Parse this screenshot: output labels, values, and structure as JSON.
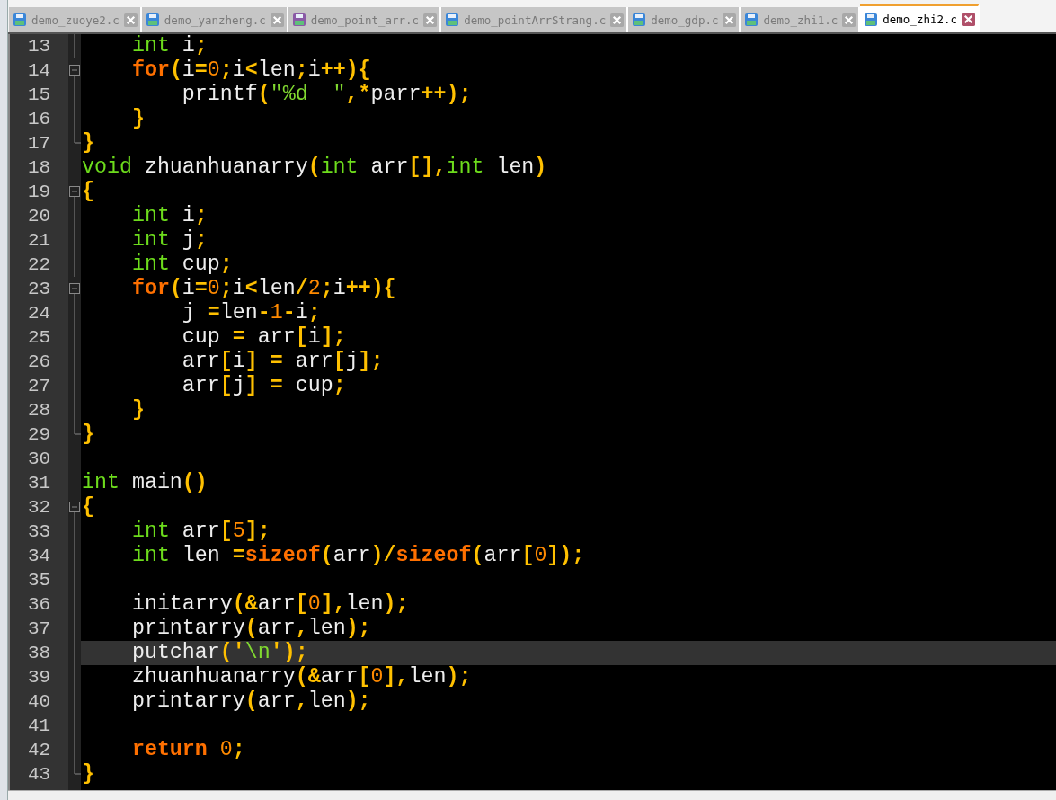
{
  "tabs": [
    {
      "label": "demo_zuoye2.c",
      "selected": false,
      "color": "#3a86d8"
    },
    {
      "label": "demo_yanzheng.c",
      "selected": false,
      "color": "#3a86d8"
    },
    {
      "label": "demo_point_arr.c",
      "selected": false,
      "color": "#8a5aa6"
    },
    {
      "label": "demo_pointArrStrang.c",
      "selected": false,
      "color": "#3a86d8"
    },
    {
      "label": "demo_gdp.c",
      "selected": false,
      "color": "#3a86d8"
    },
    {
      "label": "demo_zhi1.c",
      "selected": false,
      "color": "#3a86d8"
    },
    {
      "label": "demo_zhi2.c",
      "selected": true,
      "color": "#3a86d8"
    }
  ],
  "lines": [
    {
      "number": "13",
      "fold": {
        "kind": "line"
      },
      "current": false,
      "tokens": [
        {
          "text": "    int",
          "kind": "type"
        },
        {
          "text": " i",
          "kind": "id"
        },
        {
          "text": ";",
          "kind": "op"
        }
      ]
    },
    {
      "number": "14",
      "fold": {
        "kind": "open"
      },
      "current": false,
      "tokens": [
        {
          "text": "    for",
          "kind": "kw"
        },
        {
          "text": "(",
          "kind": "op"
        },
        {
          "text": "i",
          "kind": "id"
        },
        {
          "text": "=",
          "kind": "op"
        },
        {
          "text": "0",
          "kind": "num"
        },
        {
          "text": ";",
          "kind": "op"
        },
        {
          "text": "i",
          "kind": "id"
        },
        {
          "text": "<",
          "kind": "op"
        },
        {
          "text": "len",
          "kind": "id"
        },
        {
          "text": ";",
          "kind": "op"
        },
        {
          "text": "i",
          "kind": "id"
        },
        {
          "text": "++",
          "kind": "op"
        },
        {
          "text": ")",
          "kind": "op"
        },
        {
          "text": "{",
          "kind": "op"
        }
      ]
    },
    {
      "number": "15",
      "fold": {
        "kind": "line"
      },
      "current": false,
      "tokens": [
        {
          "text": "        printf",
          "kind": "id"
        },
        {
          "text": "(",
          "kind": "op"
        },
        {
          "text": "\"%d  \"",
          "kind": "str"
        },
        {
          "text": ",",
          "kind": "op"
        },
        {
          "text": "*",
          "kind": "op"
        },
        {
          "text": "parr",
          "kind": "id"
        },
        {
          "text": "++",
          "kind": "op"
        },
        {
          "text": ")",
          "kind": "op"
        },
        {
          "text": ";",
          "kind": "op"
        }
      ]
    },
    {
      "number": "16",
      "fold": {
        "kind": "line"
      },
      "current": false,
      "tokens": [
        {
          "text": "    }",
          "kind": "op"
        }
      ]
    },
    {
      "number": "17",
      "fold": {
        "kind": "end"
      },
      "current": false,
      "tokens": [
        {
          "text": "}",
          "kind": "op"
        }
      ]
    },
    {
      "number": "18",
      "current": false,
      "tokens": [
        {
          "text": "void",
          "kind": "type"
        },
        {
          "text": " zhuanhuanarry",
          "kind": "id"
        },
        {
          "text": "(",
          "kind": "op"
        },
        {
          "text": "int",
          "kind": "type"
        },
        {
          "text": " arr",
          "kind": "id"
        },
        {
          "text": "[]",
          "kind": "op"
        },
        {
          "text": ",",
          "kind": "op"
        },
        {
          "text": "int",
          "kind": "type"
        },
        {
          "text": " len",
          "kind": "id"
        },
        {
          "text": ")",
          "kind": "op"
        }
      ]
    },
    {
      "number": "19",
      "fold": {
        "kind": "open"
      },
      "current": false,
      "tokens": [
        {
          "text": "{",
          "kind": "op"
        }
      ]
    },
    {
      "number": "20",
      "fold": {
        "kind": "line"
      },
      "current": false,
      "tokens": [
        {
          "text": "    int",
          "kind": "type"
        },
        {
          "text": " i",
          "kind": "id"
        },
        {
          "text": ";",
          "kind": "op"
        }
      ]
    },
    {
      "number": "21",
      "fold": {
        "kind": "line"
      },
      "current": false,
      "tokens": [
        {
          "text": "    int",
          "kind": "type"
        },
        {
          "text": " j",
          "kind": "id"
        },
        {
          "text": ";",
          "kind": "op"
        }
      ]
    },
    {
      "number": "22",
      "fold": {
        "kind": "line"
      },
      "current": false,
      "tokens": [
        {
          "text": "    int",
          "kind": "type"
        },
        {
          "text": " cup",
          "kind": "id"
        },
        {
          "text": ";",
          "kind": "op"
        }
      ]
    },
    {
      "number": "23",
      "fold": {
        "kind": "open"
      },
      "current": false,
      "tokens": [
        {
          "text": "    for",
          "kind": "kw"
        },
        {
          "text": "(",
          "kind": "op"
        },
        {
          "text": "i",
          "kind": "id"
        },
        {
          "text": "=",
          "kind": "op"
        },
        {
          "text": "0",
          "kind": "num"
        },
        {
          "text": ";",
          "kind": "op"
        },
        {
          "text": "i",
          "kind": "id"
        },
        {
          "text": "<",
          "kind": "op"
        },
        {
          "text": "len",
          "kind": "id"
        },
        {
          "text": "/",
          "kind": "op"
        },
        {
          "text": "2",
          "kind": "num"
        },
        {
          "text": ";",
          "kind": "op"
        },
        {
          "text": "i",
          "kind": "id"
        },
        {
          "text": "++",
          "kind": "op"
        },
        {
          "text": ")",
          "kind": "op"
        },
        {
          "text": "{",
          "kind": "op"
        }
      ]
    },
    {
      "number": "24",
      "fold": {
        "kind": "line"
      },
      "current": false,
      "tokens": [
        {
          "text": "        j ",
          "kind": "id"
        },
        {
          "text": "=",
          "kind": "op"
        },
        {
          "text": "len",
          "kind": "id"
        },
        {
          "text": "-",
          "kind": "op"
        },
        {
          "text": "1",
          "kind": "num"
        },
        {
          "text": "-",
          "kind": "op"
        },
        {
          "text": "i",
          "kind": "id"
        },
        {
          "text": ";",
          "kind": "op"
        }
      ]
    },
    {
      "number": "25",
      "fold": {
        "kind": "line"
      },
      "current": false,
      "tokens": [
        {
          "text": "        cup ",
          "kind": "id"
        },
        {
          "text": "=",
          "kind": "op"
        },
        {
          "text": " arr",
          "kind": "id"
        },
        {
          "text": "[",
          "kind": "op"
        },
        {
          "text": "i",
          "kind": "id"
        },
        {
          "text": "]",
          "kind": "op"
        },
        {
          "text": ";",
          "kind": "op"
        }
      ]
    },
    {
      "number": "26",
      "fold": {
        "kind": "line"
      },
      "current": false,
      "tokens": [
        {
          "text": "        arr",
          "kind": "id"
        },
        {
          "text": "[",
          "kind": "op"
        },
        {
          "text": "i",
          "kind": "id"
        },
        {
          "text": "]",
          "kind": "op"
        },
        {
          "text": " =",
          "kind": "op"
        },
        {
          "text": " arr",
          "kind": "id"
        },
        {
          "text": "[",
          "kind": "op"
        },
        {
          "text": "j",
          "kind": "id"
        },
        {
          "text": "]",
          "kind": "op"
        },
        {
          "text": ";",
          "kind": "op"
        }
      ]
    },
    {
      "number": "27",
      "fold": {
        "kind": "line"
      },
      "current": false,
      "tokens": [
        {
          "text": "        arr",
          "kind": "id"
        },
        {
          "text": "[",
          "kind": "op"
        },
        {
          "text": "j",
          "kind": "id"
        },
        {
          "text": "]",
          "kind": "op"
        },
        {
          "text": " =",
          "kind": "op"
        },
        {
          "text": " cup",
          "kind": "id"
        },
        {
          "text": ";",
          "kind": "op"
        }
      ]
    },
    {
      "number": "28",
      "fold": {
        "kind": "line"
      },
      "current": false,
      "tokens": [
        {
          "text": "    }",
          "kind": "op"
        }
      ]
    },
    {
      "number": "29",
      "fold": {
        "kind": "end"
      },
      "current": false,
      "tokens": [
        {
          "text": "}",
          "kind": "op"
        }
      ]
    },
    {
      "number": "30",
      "current": false
    },
    {
      "number": "31",
      "current": false,
      "tokens": [
        {
          "text": "int",
          "kind": "type"
        },
        {
          "text": " main",
          "kind": "id"
        },
        {
          "text": "()",
          "kind": "op"
        }
      ]
    },
    {
      "number": "32",
      "fold": {
        "kind": "open"
      },
      "current": false,
      "tokens": [
        {
          "text": "{",
          "kind": "op"
        }
      ]
    },
    {
      "number": "33",
      "fold": {
        "kind": "line"
      },
      "current": false,
      "tokens": [
        {
          "text": "    int",
          "kind": "type"
        },
        {
          "text": " arr",
          "kind": "id"
        },
        {
          "text": "[",
          "kind": "op"
        },
        {
          "text": "5",
          "kind": "num"
        },
        {
          "text": "]",
          "kind": "op"
        },
        {
          "text": ";",
          "kind": "op"
        }
      ]
    },
    {
      "number": "34",
      "fold": {
        "kind": "line"
      },
      "current": false,
      "tokens": [
        {
          "text": "    int",
          "kind": "type"
        },
        {
          "text": " len ",
          "kind": "id"
        },
        {
          "text": "=",
          "kind": "op"
        },
        {
          "text": "sizeof",
          "kind": "kw"
        },
        {
          "text": "(",
          "kind": "op"
        },
        {
          "text": "arr",
          "kind": "id"
        },
        {
          "text": ")",
          "kind": "op"
        },
        {
          "text": "/",
          "kind": "op"
        },
        {
          "text": "sizeof",
          "kind": "kw"
        },
        {
          "text": "(",
          "kind": "op"
        },
        {
          "text": "arr",
          "kind": "id"
        },
        {
          "text": "[",
          "kind": "op"
        },
        {
          "text": "0",
          "kind": "num"
        },
        {
          "text": "]",
          "kind": "op"
        },
        {
          "text": ")",
          "kind": "op"
        },
        {
          "text": ";",
          "kind": "op"
        }
      ]
    },
    {
      "number": "35",
      "fold": {
        "kind": "line"
      },
      "current": false
    },
    {
      "number": "36",
      "fold": {
        "kind": "line"
      },
      "current": false,
      "tokens": [
        {
          "text": "    initarry",
          "kind": "id"
        },
        {
          "text": "(",
          "kind": "op"
        },
        {
          "text": "&",
          "kind": "op"
        },
        {
          "text": "arr",
          "kind": "id"
        },
        {
          "text": "[",
          "kind": "op"
        },
        {
          "text": "0",
          "kind": "num"
        },
        {
          "text": "]",
          "kind": "op"
        },
        {
          "text": ",",
          "kind": "op"
        },
        {
          "text": "len",
          "kind": "id"
        },
        {
          "text": ")",
          "kind": "op"
        },
        {
          "text": ";",
          "kind": "op"
        }
      ]
    },
    {
      "number": "37",
      "fold": {
        "kind": "line"
      },
      "current": false,
      "tokens": [
        {
          "text": "    printarry",
          "kind": "id"
        },
        {
          "text": "(",
          "kind": "op"
        },
        {
          "text": "arr",
          "kind": "id"
        },
        {
          "text": ",",
          "kind": "op"
        },
        {
          "text": "len",
          "kind": "id"
        },
        {
          "text": ")",
          "kind": "op"
        },
        {
          "text": ";",
          "kind": "op"
        }
      ]
    },
    {
      "number": "38",
      "fold": {
        "kind": "line"
      },
      "current": true,
      "tokens": [
        {
          "text": "    putchar",
          "kind": "id"
        },
        {
          "text": "(",
          "kind": "op"
        },
        {
          "text": "'",
          "kind": "op"
        },
        {
          "text": "\\n",
          "kind": "str"
        },
        {
          "text": "'",
          "kind": "op"
        },
        {
          "text": ")",
          "kind": "op"
        },
        {
          "text": ";",
          "kind": "op"
        }
      ]
    },
    {
      "number": "39",
      "fold": {
        "kind": "line"
      },
      "current": false,
      "tokens": [
        {
          "text": "    zhuanhuanarry",
          "kind": "id"
        },
        {
          "text": "(",
          "kind": "op"
        },
        {
          "text": "&",
          "kind": "op"
        },
        {
          "text": "arr",
          "kind": "id"
        },
        {
          "text": "[",
          "kind": "op"
        },
        {
          "text": "0",
          "kind": "num"
        },
        {
          "text": "]",
          "kind": "op"
        },
        {
          "text": ",",
          "kind": "op"
        },
        {
          "text": "len",
          "kind": "id"
        },
        {
          "text": ")",
          "kind": "op"
        },
        {
          "text": ";",
          "kind": "op"
        }
      ]
    },
    {
      "number": "40",
      "fold": {
        "kind": "line"
      },
      "current": false,
      "tokens": [
        {
          "text": "    printarry",
          "kind": "id"
        },
        {
          "text": "(",
          "kind": "op"
        },
        {
          "text": "arr",
          "kind": "id"
        },
        {
          "text": ",",
          "kind": "op"
        },
        {
          "text": "len",
          "kind": "id"
        },
        {
          "text": ")",
          "kind": "op"
        },
        {
          "text": ";",
          "kind": "op"
        }
      ]
    },
    {
      "number": "41",
      "fold": {
        "kind": "line"
      },
      "current": false
    },
    {
      "number": "42",
      "fold": {
        "kind": "line"
      },
      "current": false,
      "tokens": [
        {
          "text": "    return",
          "kind": "kw"
        },
        {
          "text": " 0",
          "kind": "num"
        },
        {
          "text": ";",
          "kind": "op"
        }
      ]
    },
    {
      "number": "43",
      "fold": {
        "kind": "end"
      },
      "current": false,
      "tokens": [
        {
          "text": "}",
          "kind": "op"
        }
      ]
    }
  ]
}
